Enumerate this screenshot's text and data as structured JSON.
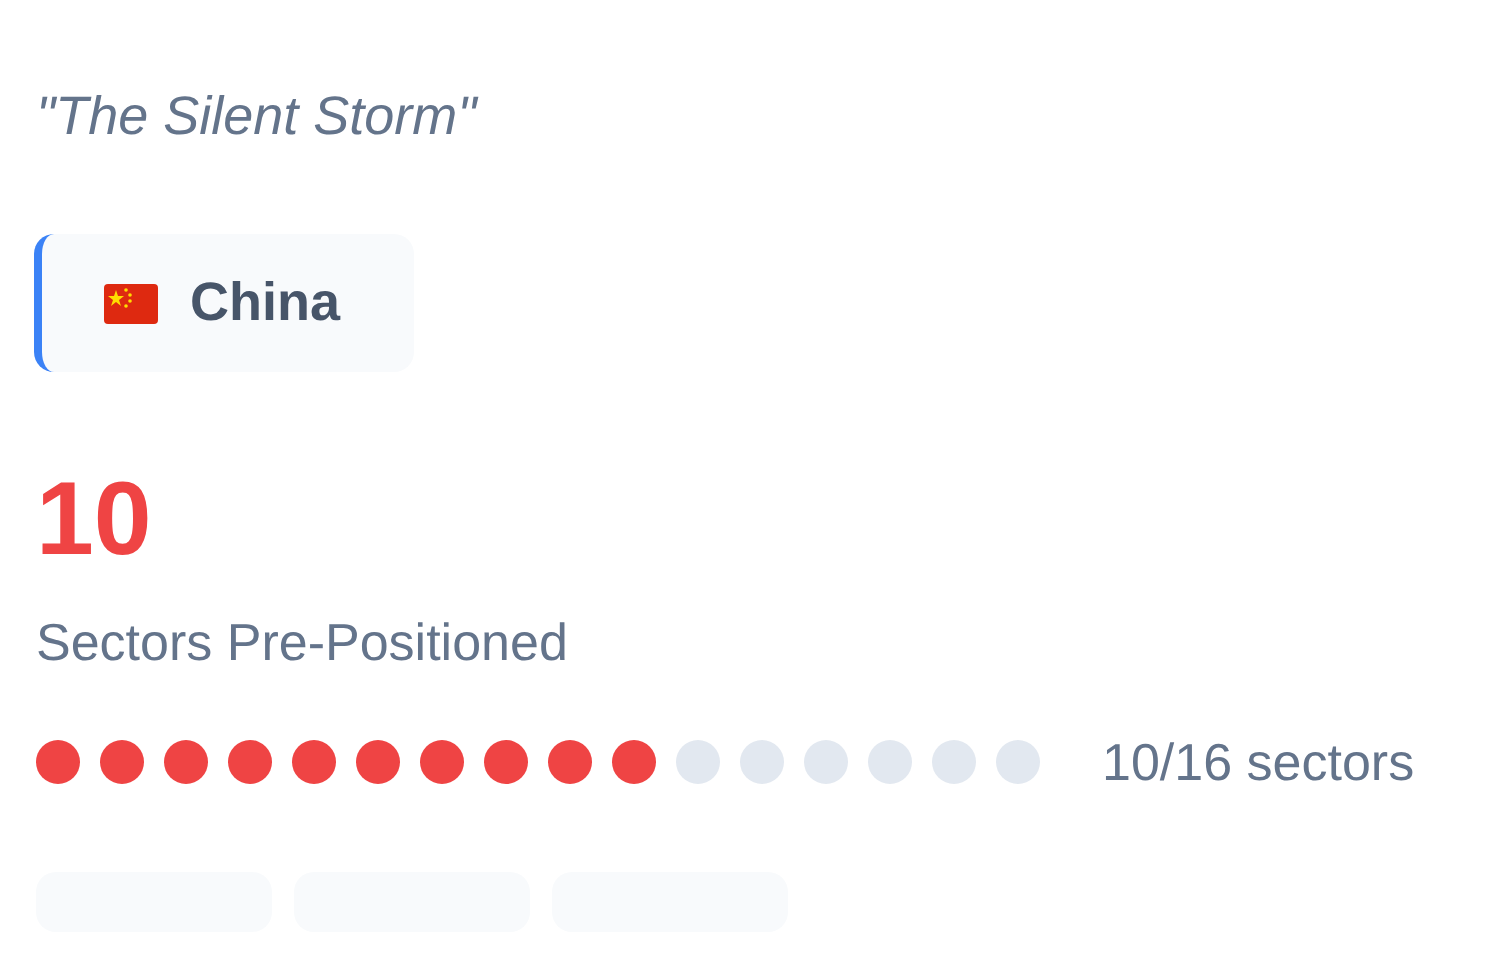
{
  "subtitle": "\"The Silent Storm\"",
  "country": {
    "name": "China",
    "selected": true
  },
  "count": "10",
  "count_label": "Sectors Pre-Positioned",
  "sectors": [
    {
      "on": true
    },
    {
      "on": true
    },
    {
      "on": true
    },
    {
      "on": true
    },
    {
      "on": true
    },
    {
      "on": true
    },
    {
      "on": true
    },
    {
      "on": true
    },
    {
      "on": true
    },
    {
      "on": true
    },
    {
      "on": false
    },
    {
      "on": false
    },
    {
      "on": false
    },
    {
      "on": false
    },
    {
      "on": false
    },
    {
      "on": false
    }
  ],
  "sectors_reading": "10/16 sectors",
  "tags": [
    {
      "kind": "blank"
    },
    {
      "kind": "blank"
    },
    {
      "kind": "blank"
    }
  ]
}
